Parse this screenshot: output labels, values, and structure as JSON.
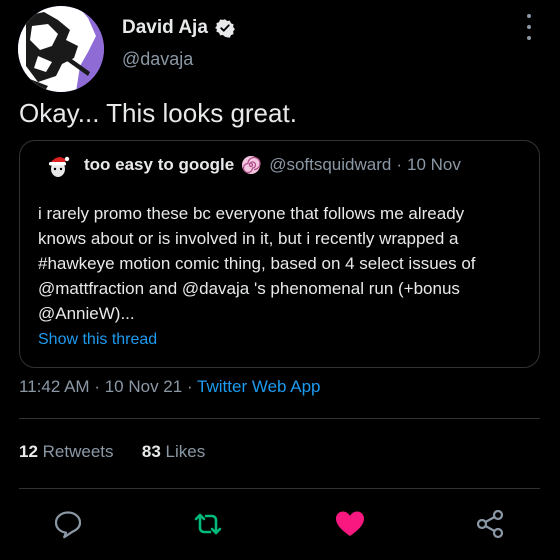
{
  "author": {
    "name": "David Aja",
    "handle": "@davaja",
    "avatar_icon": "avatar-illustration",
    "verified_icon": "verified-badge-icon"
  },
  "tweet": {
    "text": "Okay... This looks great."
  },
  "quote": {
    "name": "too easy to google",
    "handle": "@softsquidward",
    "separator": "·",
    "date": "10 Nov",
    "avatar_icon": "santa-hat-avatar-icon",
    "name_emoji_icon": "spiral-icon",
    "lines": [
      "i rarely promo these bc everyone that follows me already",
      "knows about or is involved in it, but i recently wrapped a",
      "#hawkeye motion comic thing, based on 4 select issues of",
      "@mattfraction and @davaja 's phenomenal run (+bonus",
      "@AnnieW)..."
    ],
    "show_thread": "Show this thread"
  },
  "meta": {
    "time": "11:42 AM",
    "separator": "·",
    "date": "10 Nov 21",
    "app": "Twitter Web App"
  },
  "stats": {
    "retweets_count": "12",
    "retweets_label": "Retweets",
    "likes_count": "83",
    "likes_label": "Likes"
  },
  "actions": {
    "reply_icon": "reply-icon",
    "retweet_icon": "retweet-icon",
    "like_icon": "heart-icon",
    "share_icon": "share-icon",
    "retweet_color": "#00ba7c",
    "like_color": "#f91880"
  }
}
